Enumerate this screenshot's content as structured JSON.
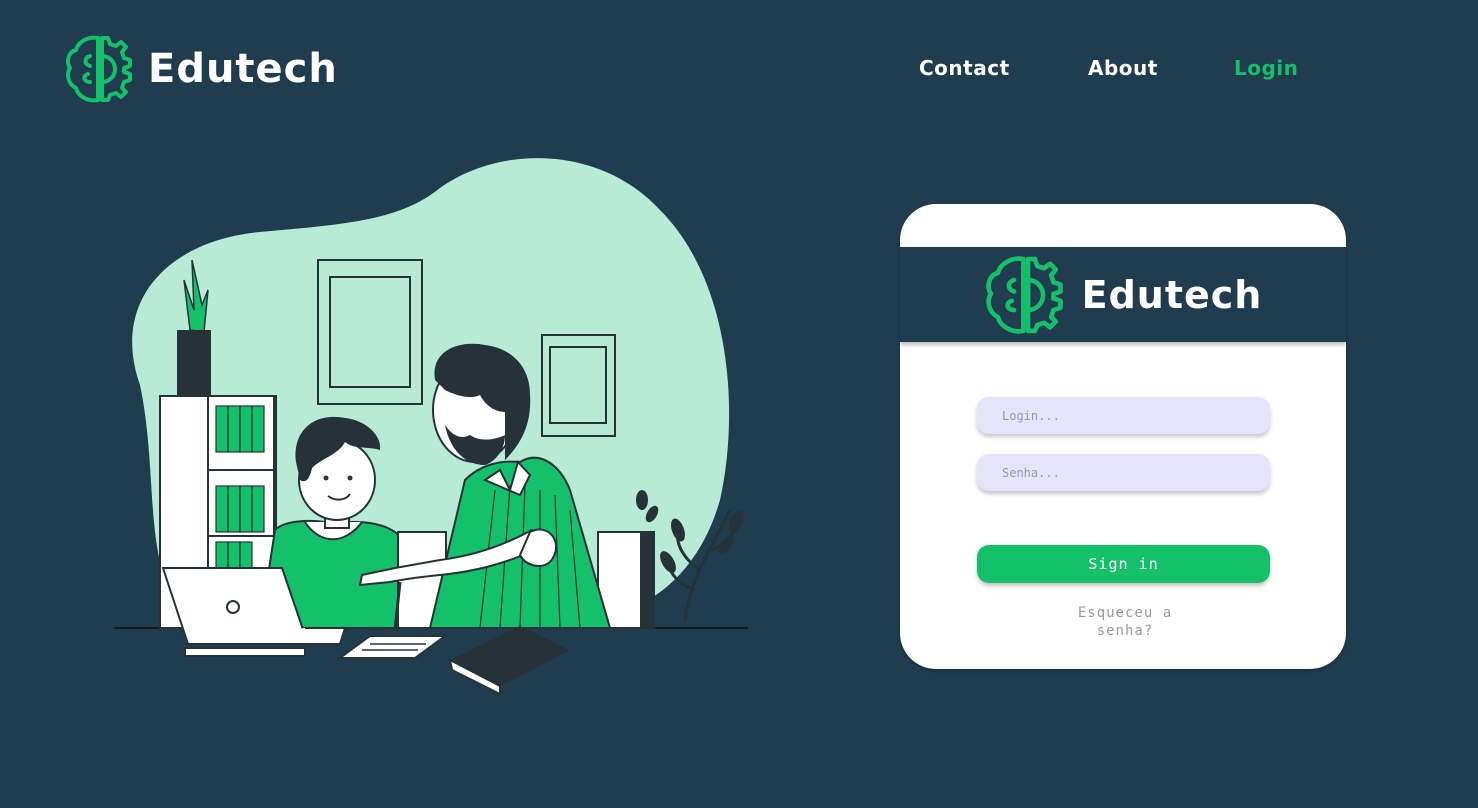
{
  "brand": {
    "name": "Edutech",
    "logo_icon": "brain-gear-icon",
    "accent": "#15c06a"
  },
  "nav": {
    "items": [
      {
        "label": "Contact"
      },
      {
        "label": "About"
      },
      {
        "label": "Login",
        "active": true
      }
    ]
  },
  "hero": {
    "illustration": "teacher-helping-student-illustration"
  },
  "login_card": {
    "brand_name": "Edutech",
    "login_placeholder": "Login...",
    "password_placeholder": "Senha...",
    "login_value": "",
    "password_value": "",
    "signin_label": "Sign in",
    "forgot_line1": "Esqueceu a",
    "forgot_line2": "senha?"
  },
  "colors": {
    "background": "#1f3d4f",
    "accent": "#15c06a",
    "blob": "#b7ebd6",
    "field": "#e6e4fb"
  }
}
